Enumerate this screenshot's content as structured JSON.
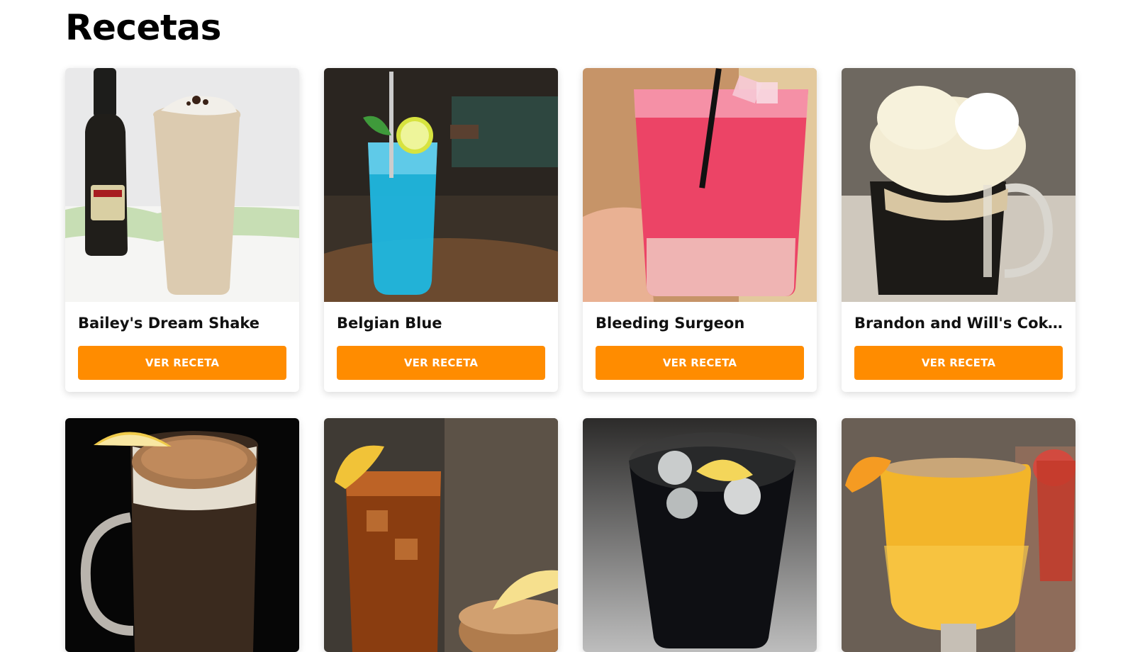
{
  "page": {
    "title": "Recetas"
  },
  "colors": {
    "accent": "#ff8c00"
  },
  "recipes": [
    {
      "name": "Bailey's Dream Shake",
      "button": "VER RECETA",
      "image": "baileys-shake-photo"
    },
    {
      "name": "Belgian Blue",
      "button": "VER RECETA",
      "image": "blue-cocktail-photo"
    },
    {
      "name": "Bleeding Surgeon",
      "button": "VER RECETA",
      "image": "red-cocktail-photo"
    },
    {
      "name": "Brandon and Will's Coke Float",
      "button": "VER RECETA",
      "image": "coke-float-photo"
    },
    {
      "name": "",
      "button": "",
      "image": "root-beer-mug-photo"
    },
    {
      "name": "",
      "button": "",
      "image": "iced-tea-lemon-photo"
    },
    {
      "name": "",
      "button": "",
      "image": "cola-glass-photo"
    },
    {
      "name": "",
      "button": "",
      "image": "orange-punch-photo"
    }
  ]
}
